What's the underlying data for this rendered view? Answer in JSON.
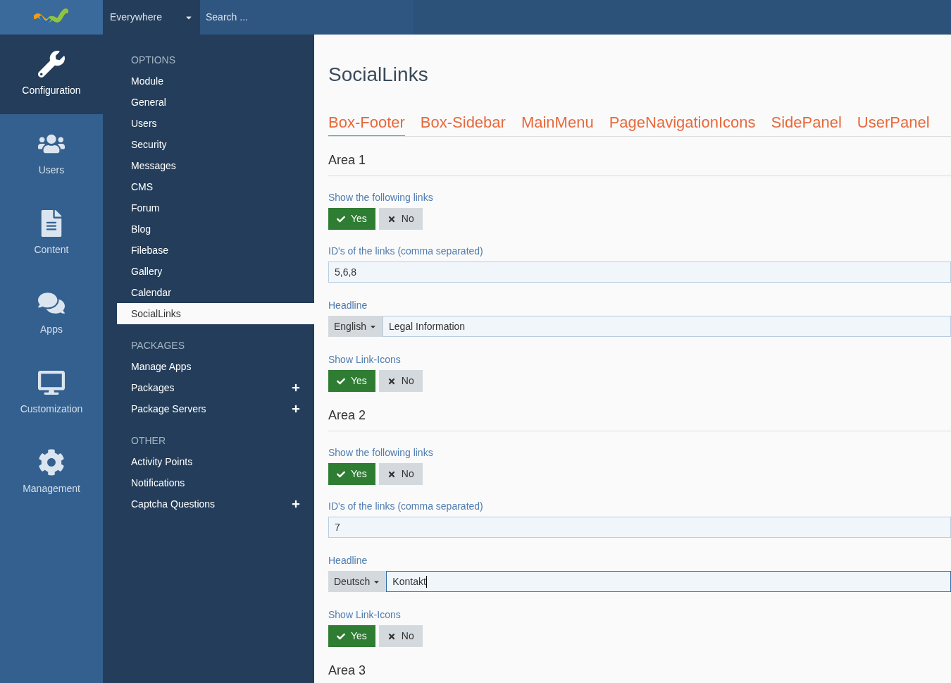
{
  "topbar": {
    "scope": "Everywhere",
    "search": {
      "placeholder": "Search ..."
    }
  },
  "rail": [
    {
      "label": "Configuration",
      "selected": true
    },
    {
      "label": "Users",
      "selected": false
    },
    {
      "label": "Content",
      "selected": false
    },
    {
      "label": "Apps",
      "selected": false
    },
    {
      "label": "Customization",
      "selected": false
    },
    {
      "label": "Management",
      "selected": false
    }
  ],
  "menu": [
    {
      "heading": "OPTIONS",
      "items": [
        {
          "label": "Module",
          "selected": false,
          "expandable": false
        },
        {
          "label": "General",
          "selected": false,
          "expandable": false
        },
        {
          "label": "Users",
          "selected": false,
          "expandable": false
        },
        {
          "label": "Security",
          "selected": false,
          "expandable": false
        },
        {
          "label": "Messages",
          "selected": false,
          "expandable": false
        },
        {
          "label": "CMS",
          "selected": false,
          "expandable": false
        },
        {
          "label": "Forum",
          "selected": false,
          "expandable": false
        },
        {
          "label": "Blog",
          "selected": false,
          "expandable": false
        },
        {
          "label": "Filebase",
          "selected": false,
          "expandable": false
        },
        {
          "label": "Gallery",
          "selected": false,
          "expandable": false
        },
        {
          "label": "Calendar",
          "selected": false,
          "expandable": false
        },
        {
          "label": "SocialLinks",
          "selected": true,
          "expandable": false
        }
      ]
    },
    {
      "heading": "PACKAGES",
      "items": [
        {
          "label": "Manage Apps",
          "selected": false,
          "expandable": false
        },
        {
          "label": "Packages",
          "selected": false,
          "expandable": true
        },
        {
          "label": "Package Servers",
          "selected": false,
          "expandable": true
        }
      ]
    },
    {
      "heading": "OTHER",
      "items": [
        {
          "label": "Activity Points",
          "selected": false,
          "expandable": false
        },
        {
          "label": "Notifications",
          "selected": false,
          "expandable": false
        },
        {
          "label": "Captcha Questions",
          "selected": false,
          "expandable": true
        }
      ]
    }
  ],
  "page": {
    "title": "SocialLinks",
    "tabs": [
      {
        "label": "Box-Footer",
        "selected": true
      },
      {
        "label": "Box-Sidebar",
        "selected": false
      },
      {
        "label": "MainMenu",
        "selected": false
      },
      {
        "label": "PageNavigationIcons",
        "selected": false
      },
      {
        "label": "SidePanel",
        "selected": false
      },
      {
        "label": "UserPanel",
        "selected": false
      }
    ],
    "areas": [
      {
        "title": "Area 1",
        "fields": [
          {
            "kind": "toggle",
            "label": "Show the following links",
            "options": [
              {
                "label": "Yes",
                "selected": true
              },
              {
                "label": "No",
                "selected": false
              }
            ]
          },
          {
            "kind": "text",
            "label": "ID's of the links (comma separated)",
            "value": "5,6,8"
          },
          {
            "kind": "i18n",
            "label": "Headline",
            "language": "English",
            "value": "Legal Information",
            "focused": false
          },
          {
            "kind": "toggle",
            "label": "Show Link-Icons",
            "options": [
              {
                "label": "Yes",
                "selected": true
              },
              {
                "label": "No",
                "selected": false
              }
            ]
          }
        ]
      },
      {
        "title": "Area 2",
        "fields": [
          {
            "kind": "toggle",
            "label": "Show the following links",
            "options": [
              {
                "label": "Yes",
                "selected": true
              },
              {
                "label": "No",
                "selected": false
              }
            ]
          },
          {
            "kind": "text",
            "label": "ID's of the links (comma separated)",
            "value": "7"
          },
          {
            "kind": "i18n",
            "label": "Headline",
            "language": "Deutsch",
            "value": "Kontakt",
            "focused": true
          },
          {
            "kind": "toggle",
            "label": "Show Link-Icons",
            "options": [
              {
                "label": "Yes",
                "selected": true
              },
              {
                "label": "No",
                "selected": false
              }
            ]
          }
        ]
      },
      {
        "title": "Area 3"
      }
    ]
  }
}
